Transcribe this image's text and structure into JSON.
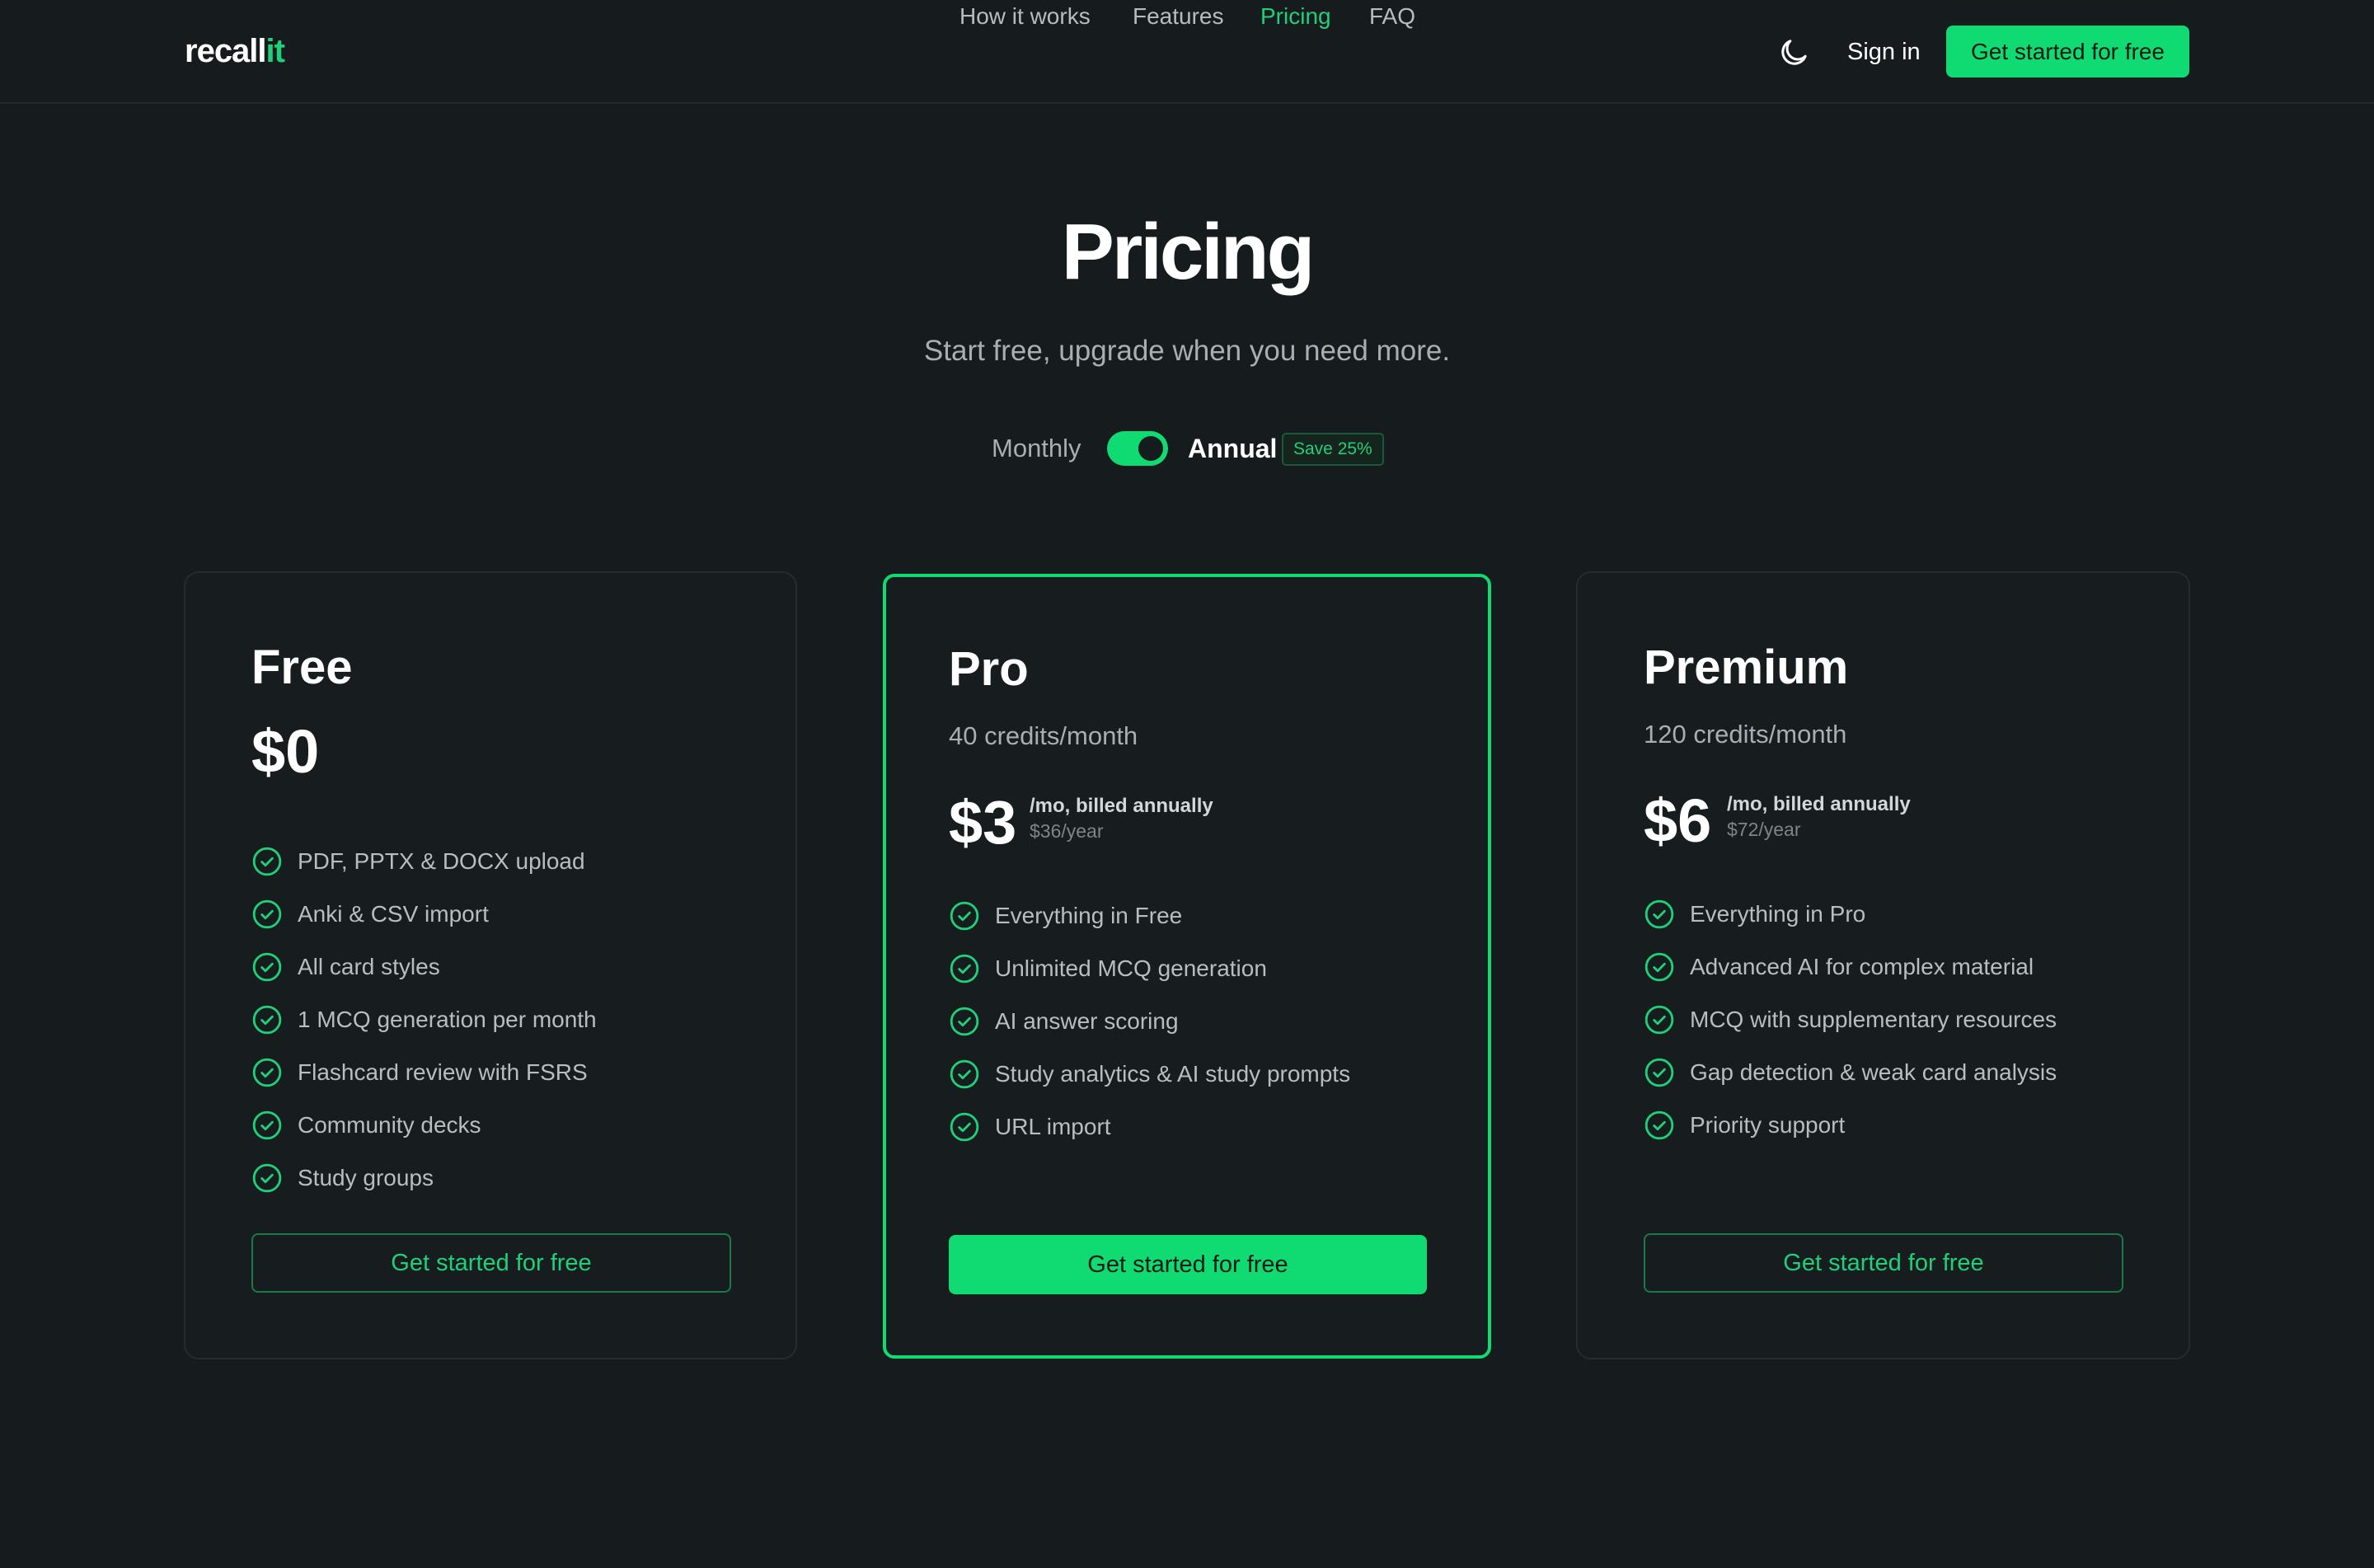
{
  "header": {
    "logo_main": "recall",
    "logo_accent": "it",
    "nav": [
      "How it works",
      "Features",
      "Pricing",
      "FAQ"
    ],
    "active_nav": "Pricing",
    "theme_icon": "moon-icon",
    "sign_in": "Sign in",
    "cta": "Get started for free"
  },
  "hero": {
    "title": "Pricing",
    "subtitle": "Start free, upgrade when you need more.",
    "billing": {
      "monthly": "Monthly",
      "annual": "Annual",
      "selected": "Annual",
      "save_badge": "Save 25%"
    }
  },
  "plans": [
    {
      "name": "Free",
      "credits": "",
      "price": "$0",
      "price_note": "",
      "price_year": "",
      "features": [
        "PDF, PPTX & DOCX upload",
        "Anki & CSV import",
        "All card styles",
        "1 MCQ generation per month",
        "Flashcard review with FSRS",
        "Community decks",
        "Study groups"
      ],
      "button": "Get started for free",
      "featured": false
    },
    {
      "name": "Pro",
      "credits": "40 credits/month",
      "price": "$3",
      "price_note": "/mo, billed annually",
      "price_year": "$36/year",
      "features": [
        "Everything in Free",
        "Unlimited MCQ generation",
        "AI answer scoring",
        "Study analytics & AI study prompts",
        "URL import"
      ],
      "button": "Get started for free",
      "featured": true
    },
    {
      "name": "Premium",
      "credits": "120 credits/month",
      "price": "$6",
      "price_note": "/mo, billed annually",
      "price_year": "$72/year",
      "features": [
        "Everything in Pro",
        "Advanced AI for complex material",
        "MCQ with supplementary resources",
        "Gap detection & weak card analysis",
        "Priority support"
      ],
      "button": "Get started for free",
      "featured": false
    }
  ],
  "colors": {
    "background": "#161b1e",
    "accent": "#10db72",
    "accent_text": "#1fd07a",
    "muted_text": "#a8aeb1"
  }
}
